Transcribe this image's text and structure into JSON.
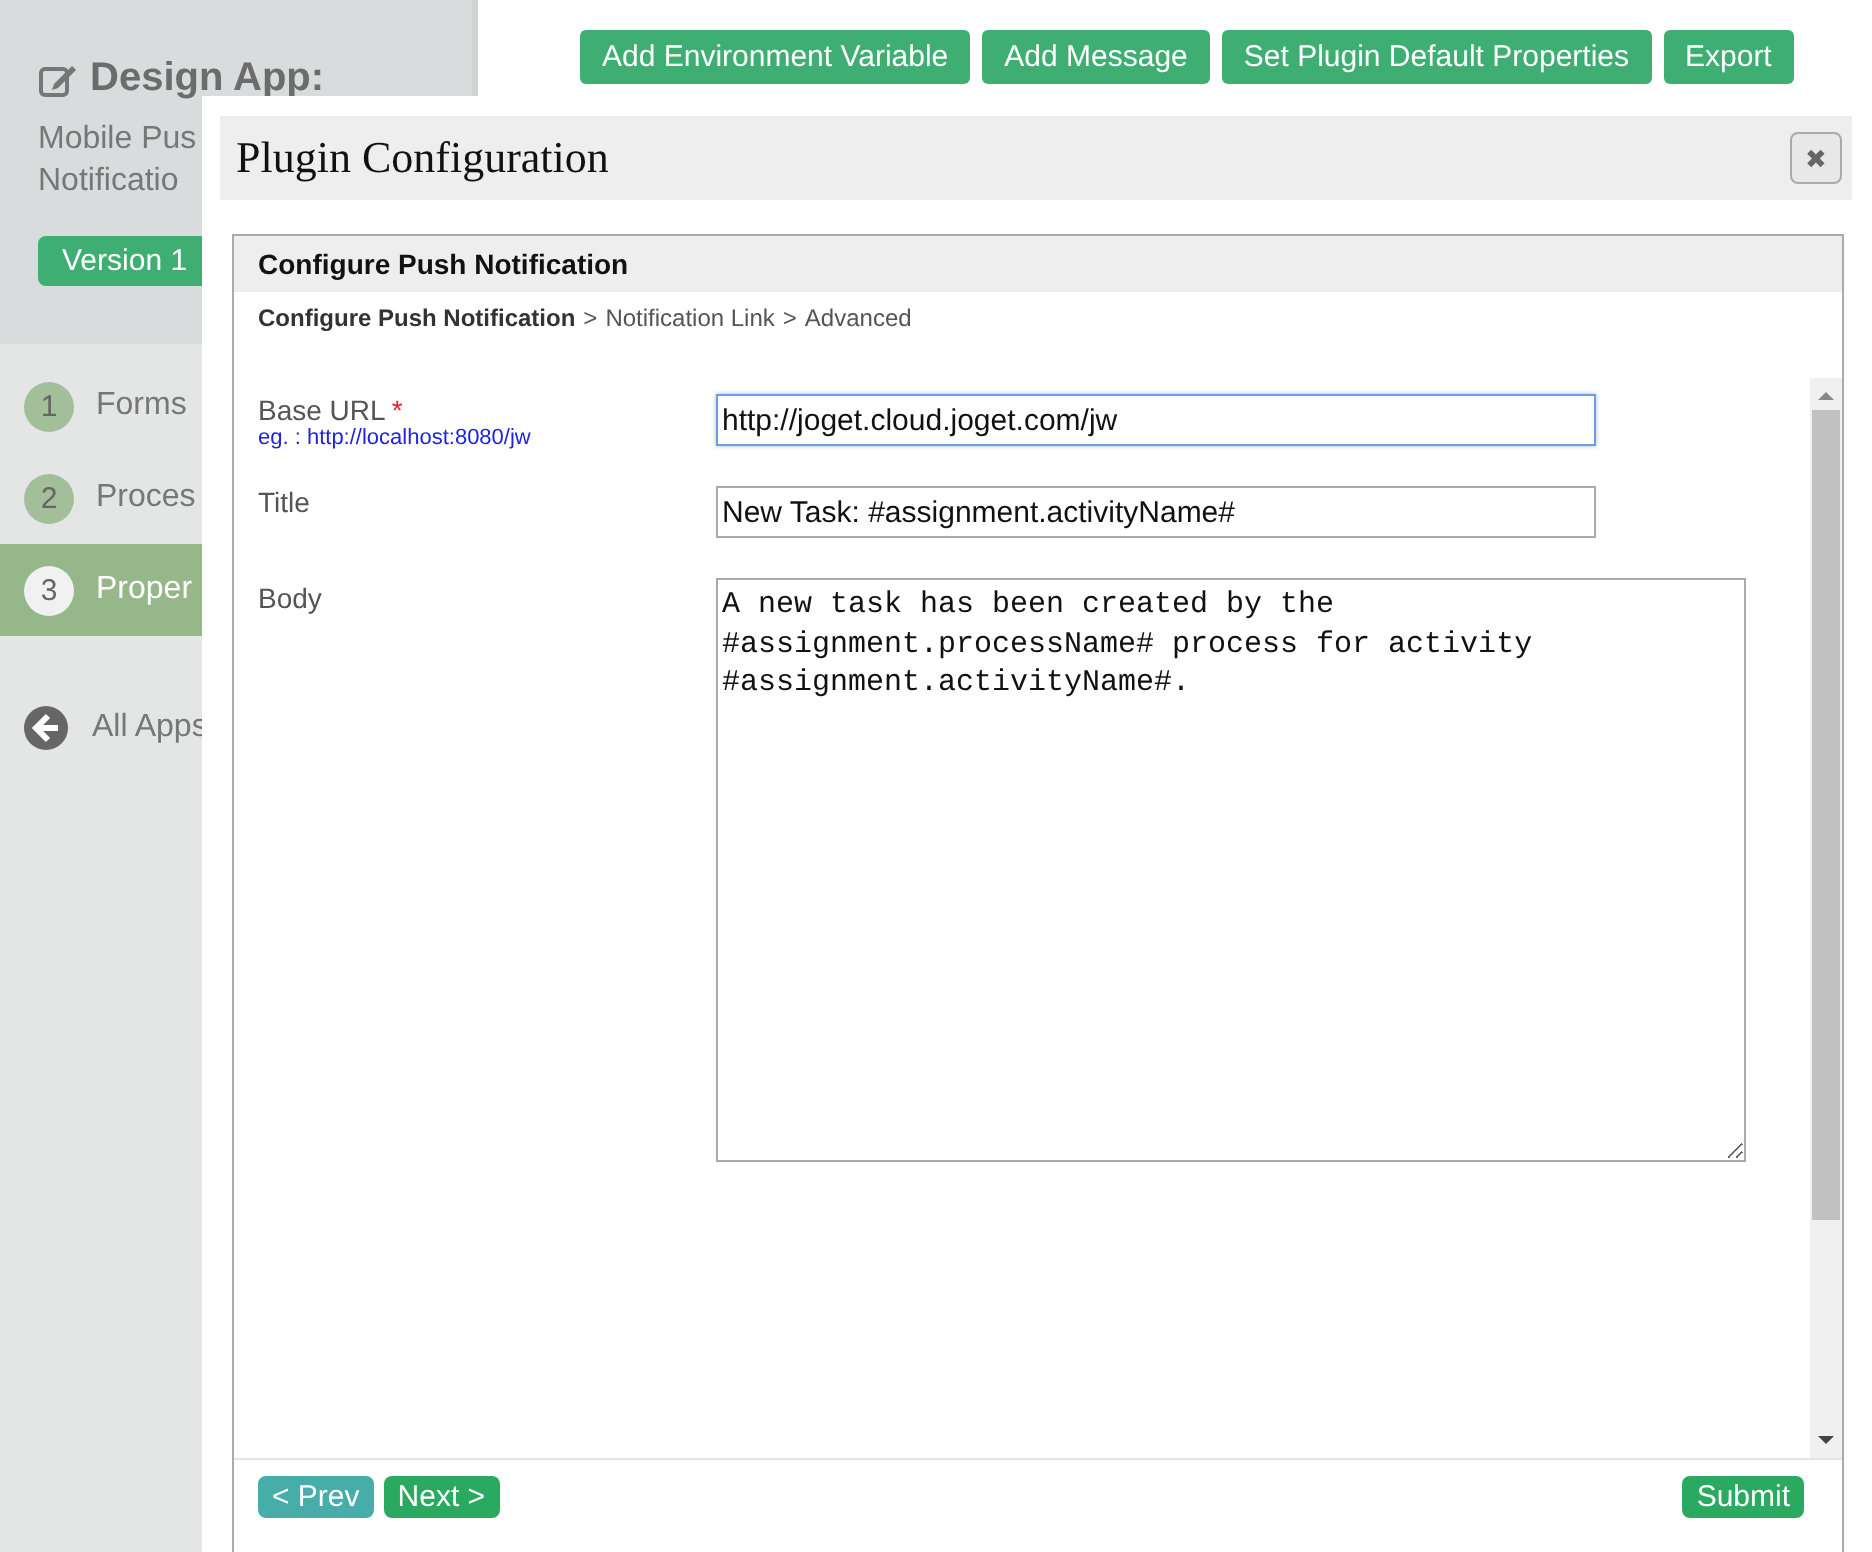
{
  "sidebar": {
    "heading": "Design App:",
    "app_name_lines": [
      "Mobile Pus",
      "Notificatio"
    ],
    "version": "Version 1",
    "steps": [
      {
        "number": "1",
        "label": "Forms",
        "selected": false
      },
      {
        "number": "2",
        "label": "Proces",
        "selected": false
      },
      {
        "number": "3",
        "label": "Proper",
        "selected": true
      }
    ],
    "back_link": "All Apps"
  },
  "toolbar": {
    "buttons": [
      "Add Environment Variable",
      "Add Message",
      "Set Plugin Default Properties",
      "Export"
    ]
  },
  "dialog": {
    "title": "Plugin Configuration",
    "close_label": "✖",
    "panel_title": "Configure Push Notification",
    "breadcrumb": {
      "current": "Configure Push Notification",
      "rest": [
        "Notification Link",
        "Advanced"
      ],
      "separator": ">"
    },
    "fields": [
      {
        "kind": "text",
        "label": "Base URL",
        "required_mark": "*",
        "hint": "eg. : http://localhost:8080/jw",
        "value": "http://joget.cloud.joget.com/jw",
        "focused": true
      },
      {
        "kind": "text",
        "label": "Title",
        "value": "New Task: #assignment.activityName#",
        "focused": false
      },
      {
        "kind": "textarea",
        "label": "Body",
        "value": "A new task has been created by the\n#assignment.processName# process for activity\n#assignment.activityName#.",
        "focused": false
      }
    ],
    "prev": "< Prev",
    "next": "Next >",
    "submit": "Submit"
  }
}
